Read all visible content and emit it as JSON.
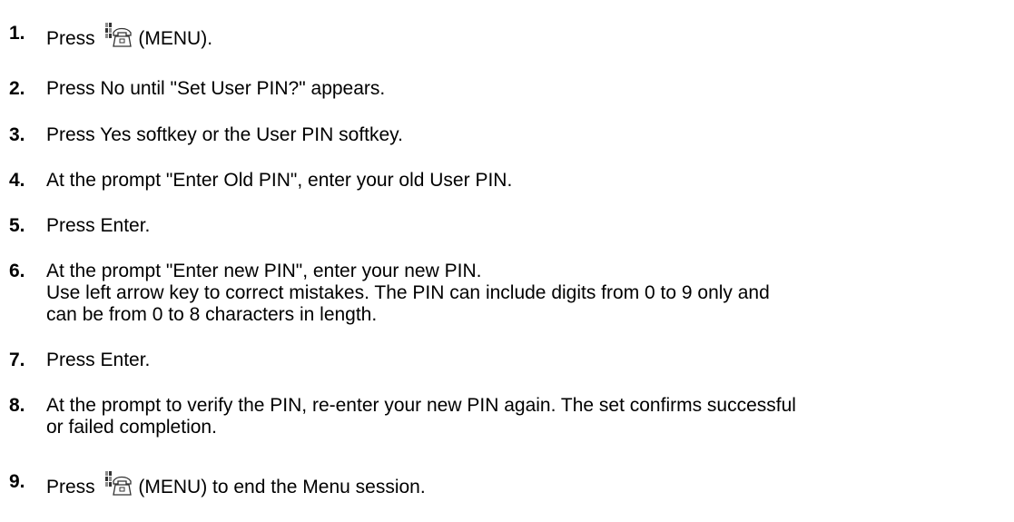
{
  "steps": [
    {
      "num": "1.",
      "before": "Press",
      "icon": "menu-phone-icon",
      "after": "(MENU)."
    },
    {
      "num": "2.",
      "text": "Press No until \"Set User PIN?\" appears."
    },
    {
      "num": "3.",
      "text": "Press Yes softkey or the User PIN softkey."
    },
    {
      "num": "4.",
      "text": "At the prompt \"Enter Old PIN\", enter your old User PIN."
    },
    {
      "num": "5.",
      "text": "Press Enter."
    },
    {
      "num": "6.",
      "line1": "At the prompt \"Enter new PIN\", enter your new PIN.",
      "line2": "Use left arrow key to correct mistakes. The PIN can include digits from 0 to 9 only and",
      "line3": "can be from 0 to 8 characters in length."
    },
    {
      "num": "7.",
      "text": "Press Enter."
    },
    {
      "num": "8.",
      "line1": "At the prompt to verify the PIN, re-enter your new PIN again. The set confirms successful",
      "line2": "or failed completion."
    },
    {
      "num": "9.",
      "before": "Press",
      "icon": "menu-phone-icon",
      "after": "(MENU) to end the Menu session."
    }
  ]
}
